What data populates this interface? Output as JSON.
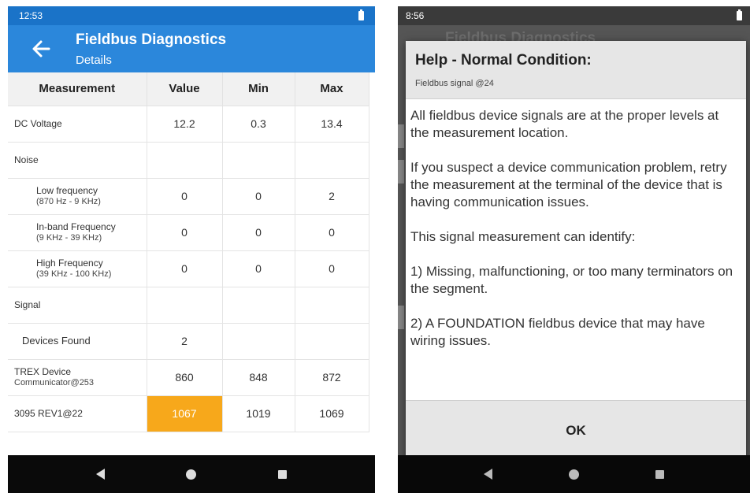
{
  "left": {
    "status_time": "12:53",
    "title": "Fieldbus Diagnostics",
    "subtitle": "Details",
    "headers": [
      "Measurement",
      "Value",
      "Min",
      "Max"
    ],
    "rows": [
      {
        "name": "DC Voltage",
        "sub": "",
        "value": "12.2",
        "min": "0.3",
        "max": "13.4"
      },
      {
        "name": "Noise",
        "sub": "",
        "value": "",
        "min": "",
        "max": ""
      },
      {
        "name": "Low frequency",
        "sub": "(870 Hz - 9 KHz)",
        "value": "0",
        "min": "0",
        "max": "2"
      },
      {
        "name": "In-band Frequency",
        "sub": "(9 KHz - 39 KHz)",
        "value": "0",
        "min": "0",
        "max": "0"
      },
      {
        "name": "High Frequency",
        "sub": "(39 KHz - 100 KHz)",
        "value": "0",
        "min": "0",
        "max": "0"
      },
      {
        "name": "Signal",
        "sub": "",
        "value": "",
        "min": "",
        "max": ""
      },
      {
        "name": "Devices Found",
        "sub": "",
        "value": "2",
        "min": "",
        "max": ""
      },
      {
        "name": "TREX Device",
        "sub": "Communicator@253",
        "value": "860",
        "min": "848",
        "max": "872"
      },
      {
        "name": "3095 REV1@22",
        "sub": "",
        "value": "1067",
        "min": "1019",
        "max": "1069"
      }
    ],
    "highlight_color": "#f7a81b"
  },
  "right": {
    "status_time": "8:56",
    "background_title": "Fieldbus Diagnostics",
    "dialog_title": "Help - Normal Condition:",
    "dialog_subtitle": "Fieldbus signal @24",
    "paragraphs": [
      "All fieldbus device signals are at the proper levels at the measurement location.",
      "If you suspect a device communication problem, retry the measurement at the terminal of the device that is having communication issues.",
      "This signal measurement can identify:",
      "1) Missing, malfunctioning, or too many terminators on the segment.",
      "2) A FOUNDATION fieldbus device that may have wiring issues."
    ],
    "ok_label": "OK"
  }
}
